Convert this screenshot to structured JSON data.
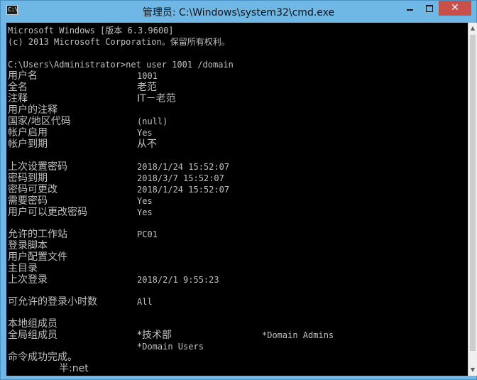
{
  "window": {
    "title": "管理员: C:\\Windows\\system32\\cmd.exe",
    "icon_name": "cmd-icon",
    "icon_text": "C:\\",
    "buttons": {
      "minimize": "minimize-icon",
      "maximize": "maximize-icon",
      "close": "✕"
    }
  },
  "console": {
    "header1": "Microsoft Windows [版本 6.3.9600]",
    "header2": "(c) 2013 Microsoft Corporation。保留所有权利。",
    "prompt": "C:\\Users\\Administrator>net user 1001 /domain",
    "rows": [
      {
        "label": "用户名",
        "value": "1001"
      },
      {
        "label": "全名",
        "value": "老范"
      },
      {
        "label": "注释",
        "value": "IT－老范"
      },
      {
        "label": "用户的注释",
        "value": ""
      },
      {
        "label": "国家/地区代码",
        "value": "(null)"
      },
      {
        "label": "帐户启用",
        "value": "Yes"
      },
      {
        "label": "帐户到期",
        "value": "从不"
      },
      {
        "label": "上次设置密码",
        "value": "2018/1/24 15:52:07"
      },
      {
        "label": "密码到期",
        "value": "2018/3/7 15:52:07"
      },
      {
        "label": "密码可更改",
        "value": "2018/1/24 15:52:07"
      },
      {
        "label": "需要密码",
        "value": "Yes"
      },
      {
        "label": "用户可以更改密码",
        "value": "Yes"
      },
      {
        "label": "允许的工作站",
        "value": "PC01"
      },
      {
        "label": "登录脚本",
        "value": ""
      },
      {
        "label": "用户配置文件",
        "value": ""
      },
      {
        "label": "主目录",
        "value": ""
      },
      {
        "label": "上次登录",
        "value": "2018/2/1 9:55:23"
      },
      {
        "label": "可允许的登录小时数",
        "value": "All"
      },
      {
        "label": "本地组成员",
        "value": ""
      },
      {
        "label": "全局组成员",
        "value": "*技术部",
        "value2": "*Domain Admins"
      },
      {
        "label": "",
        "value": "*Domain Users"
      }
    ],
    "footer": "命令成功完成。",
    "ime_text": "半:net"
  },
  "colors": {
    "title_bar": "#6fb7e5",
    "close_button": "#c7504a",
    "console_bg": "#000000",
    "console_text": "#c0c0c0"
  }
}
